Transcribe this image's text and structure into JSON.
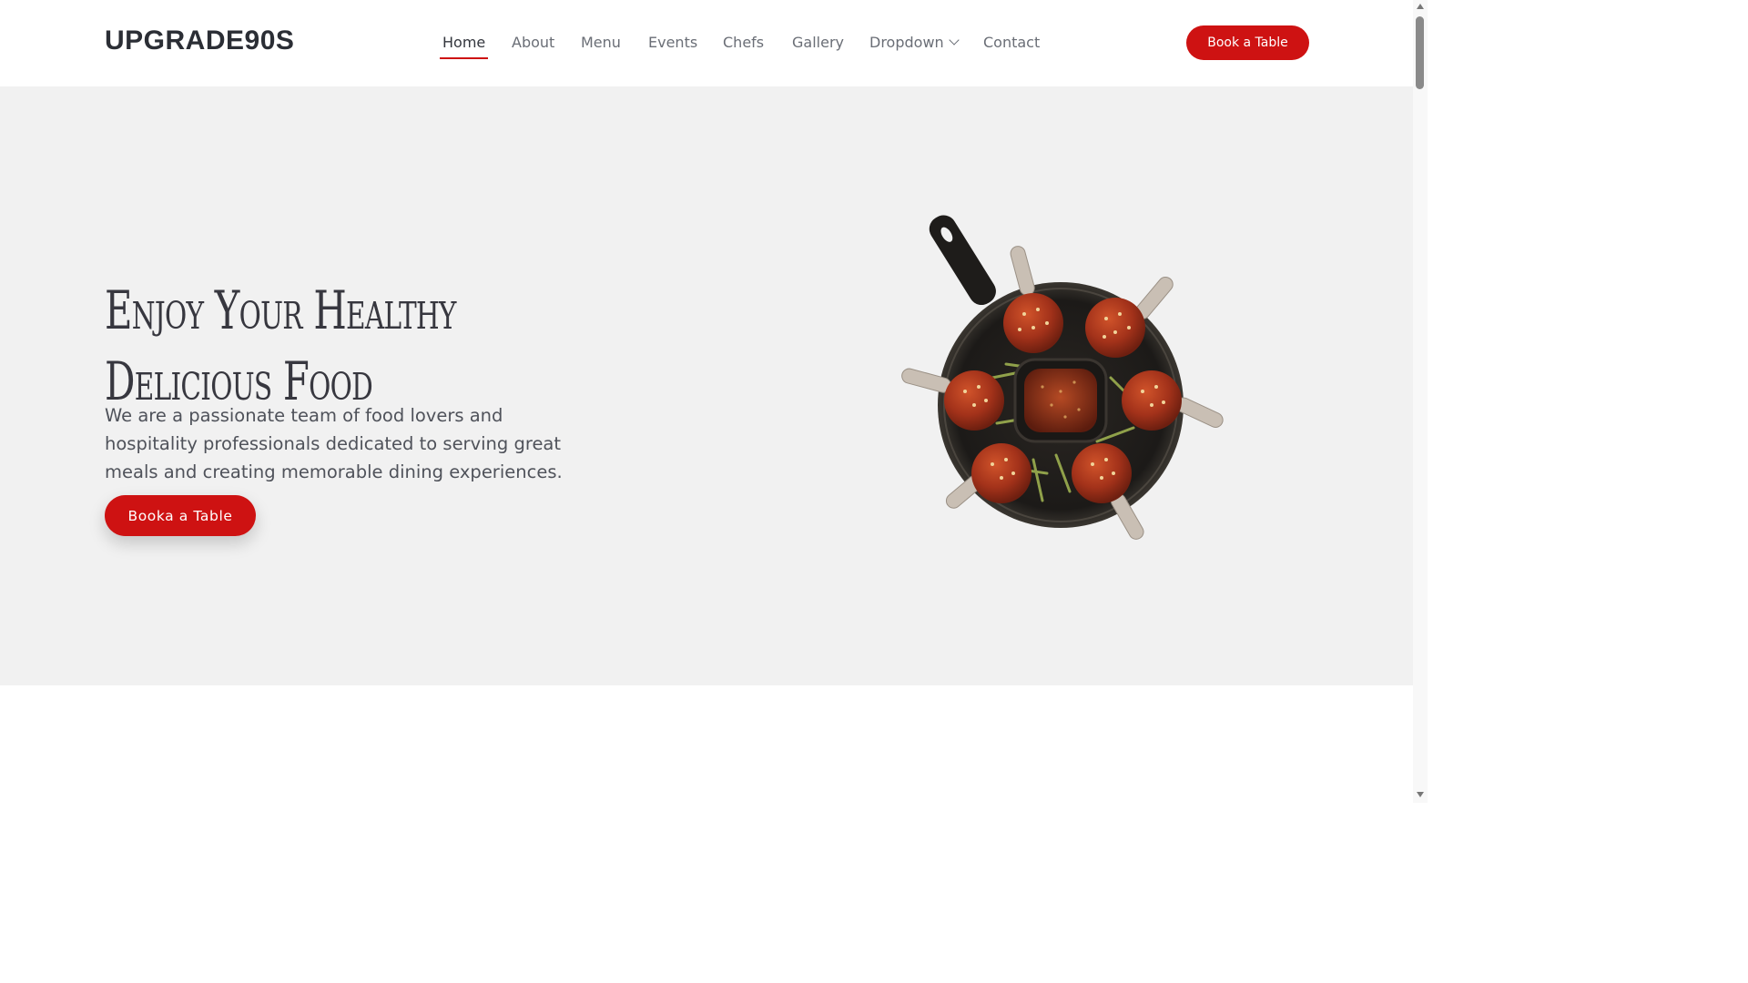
{
  "brand": {
    "logo": "UPGRADE90S"
  },
  "nav": {
    "items": [
      {
        "label": "Home",
        "active": true
      },
      {
        "label": "About"
      },
      {
        "label": "Menu"
      },
      {
        "label": "Events"
      },
      {
        "label": "Chefs"
      },
      {
        "label": "Gallery"
      },
      {
        "label": "Dropdown",
        "icon": "chevron-down-icon"
      },
      {
        "label": "Contact"
      }
    ],
    "cta": "Book a Table"
  },
  "hero": {
    "title_line1": "Enjoy Your Healthy",
    "title_line2": "Delicious Food",
    "text": "We are a passionate team of food lovers and hospitality professionals dedicated to serving great meals and creating memorable dining experiences.",
    "cta": "Booka a Table",
    "image": "drumsticks-skillet-image"
  },
  "colors": {
    "accent": "#ce1212",
    "hero_bg": "#f1f1f1",
    "text_dark": "#37373f"
  }
}
